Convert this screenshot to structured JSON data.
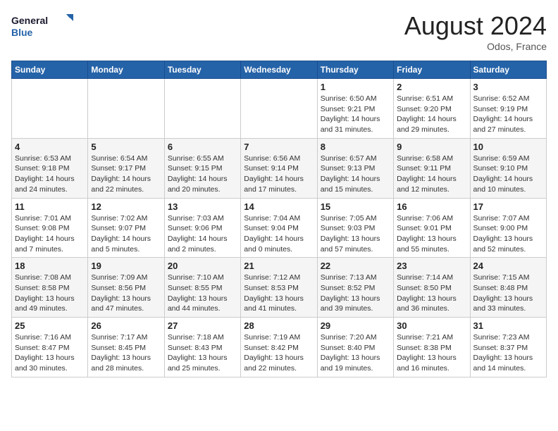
{
  "logo": {
    "line1": "General",
    "line2": "Blue"
  },
  "title": "August 2024",
  "location": "Odos, France",
  "days_of_week": [
    "Sunday",
    "Monday",
    "Tuesday",
    "Wednesday",
    "Thursday",
    "Friday",
    "Saturday"
  ],
  "weeks": [
    [
      {
        "day": "",
        "info": ""
      },
      {
        "day": "",
        "info": ""
      },
      {
        "day": "",
        "info": ""
      },
      {
        "day": "",
        "info": ""
      },
      {
        "day": "1",
        "info": "Sunrise: 6:50 AM\nSunset: 9:21 PM\nDaylight: 14 hours\nand 31 minutes."
      },
      {
        "day": "2",
        "info": "Sunrise: 6:51 AM\nSunset: 9:20 PM\nDaylight: 14 hours\nand 29 minutes."
      },
      {
        "day": "3",
        "info": "Sunrise: 6:52 AM\nSunset: 9:19 PM\nDaylight: 14 hours\nand 27 minutes."
      }
    ],
    [
      {
        "day": "4",
        "info": "Sunrise: 6:53 AM\nSunset: 9:18 PM\nDaylight: 14 hours\nand 24 minutes."
      },
      {
        "day": "5",
        "info": "Sunrise: 6:54 AM\nSunset: 9:17 PM\nDaylight: 14 hours\nand 22 minutes."
      },
      {
        "day": "6",
        "info": "Sunrise: 6:55 AM\nSunset: 9:15 PM\nDaylight: 14 hours\nand 20 minutes."
      },
      {
        "day": "7",
        "info": "Sunrise: 6:56 AM\nSunset: 9:14 PM\nDaylight: 14 hours\nand 17 minutes."
      },
      {
        "day": "8",
        "info": "Sunrise: 6:57 AM\nSunset: 9:13 PM\nDaylight: 14 hours\nand 15 minutes."
      },
      {
        "day": "9",
        "info": "Sunrise: 6:58 AM\nSunset: 9:11 PM\nDaylight: 14 hours\nand 12 minutes."
      },
      {
        "day": "10",
        "info": "Sunrise: 6:59 AM\nSunset: 9:10 PM\nDaylight: 14 hours\nand 10 minutes."
      }
    ],
    [
      {
        "day": "11",
        "info": "Sunrise: 7:01 AM\nSunset: 9:08 PM\nDaylight: 14 hours\nand 7 minutes."
      },
      {
        "day": "12",
        "info": "Sunrise: 7:02 AM\nSunset: 9:07 PM\nDaylight: 14 hours\nand 5 minutes."
      },
      {
        "day": "13",
        "info": "Sunrise: 7:03 AM\nSunset: 9:06 PM\nDaylight: 14 hours\nand 2 minutes."
      },
      {
        "day": "14",
        "info": "Sunrise: 7:04 AM\nSunset: 9:04 PM\nDaylight: 14 hours\nand 0 minutes."
      },
      {
        "day": "15",
        "info": "Sunrise: 7:05 AM\nSunset: 9:03 PM\nDaylight: 13 hours\nand 57 minutes."
      },
      {
        "day": "16",
        "info": "Sunrise: 7:06 AM\nSunset: 9:01 PM\nDaylight: 13 hours\nand 55 minutes."
      },
      {
        "day": "17",
        "info": "Sunrise: 7:07 AM\nSunset: 9:00 PM\nDaylight: 13 hours\nand 52 minutes."
      }
    ],
    [
      {
        "day": "18",
        "info": "Sunrise: 7:08 AM\nSunset: 8:58 PM\nDaylight: 13 hours\nand 49 minutes."
      },
      {
        "day": "19",
        "info": "Sunrise: 7:09 AM\nSunset: 8:56 PM\nDaylight: 13 hours\nand 47 minutes."
      },
      {
        "day": "20",
        "info": "Sunrise: 7:10 AM\nSunset: 8:55 PM\nDaylight: 13 hours\nand 44 minutes."
      },
      {
        "day": "21",
        "info": "Sunrise: 7:12 AM\nSunset: 8:53 PM\nDaylight: 13 hours\nand 41 minutes."
      },
      {
        "day": "22",
        "info": "Sunrise: 7:13 AM\nSunset: 8:52 PM\nDaylight: 13 hours\nand 39 minutes."
      },
      {
        "day": "23",
        "info": "Sunrise: 7:14 AM\nSunset: 8:50 PM\nDaylight: 13 hours\nand 36 minutes."
      },
      {
        "day": "24",
        "info": "Sunrise: 7:15 AM\nSunset: 8:48 PM\nDaylight: 13 hours\nand 33 minutes."
      }
    ],
    [
      {
        "day": "25",
        "info": "Sunrise: 7:16 AM\nSunset: 8:47 PM\nDaylight: 13 hours\nand 30 minutes."
      },
      {
        "day": "26",
        "info": "Sunrise: 7:17 AM\nSunset: 8:45 PM\nDaylight: 13 hours\nand 28 minutes."
      },
      {
        "day": "27",
        "info": "Sunrise: 7:18 AM\nSunset: 8:43 PM\nDaylight: 13 hours\nand 25 minutes."
      },
      {
        "day": "28",
        "info": "Sunrise: 7:19 AM\nSunset: 8:42 PM\nDaylight: 13 hours\nand 22 minutes."
      },
      {
        "day": "29",
        "info": "Sunrise: 7:20 AM\nSunset: 8:40 PM\nDaylight: 13 hours\nand 19 minutes."
      },
      {
        "day": "30",
        "info": "Sunrise: 7:21 AM\nSunset: 8:38 PM\nDaylight: 13 hours\nand 16 minutes."
      },
      {
        "day": "31",
        "info": "Sunrise: 7:23 AM\nSunset: 8:37 PM\nDaylight: 13 hours\nand 14 minutes."
      }
    ]
  ]
}
